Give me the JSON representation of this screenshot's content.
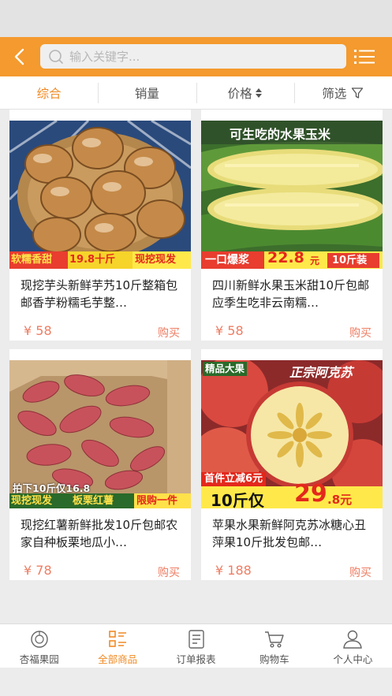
{
  "header": {
    "search_placeholder": "输入关键字..."
  },
  "filters": [
    {
      "label": "综合"
    },
    {
      "label": "销量"
    },
    {
      "label": "价格"
    },
    {
      "label": "筛选"
    }
  ],
  "products": [
    {
      "title": "现挖芋头新鲜芋艿10斤整箱包邮香芋粉糯毛芋整…",
      "price": "¥ 58",
      "buy_label": "购买",
      "image_text": {
        "left": "软糯香甜",
        "mid": "19.8十斤",
        "right": "现挖现发"
      }
    },
    {
      "title": "四川新鲜水果玉米甜10斤包邮应季生吃非云南糯…",
      "price": "¥ 58",
      "buy_label": "购买",
      "image_text": {
        "top": "可生吃的水果玉米",
        "left": "一口爆浆",
        "price": "22.8",
        "unit": "元",
        "right": "10斤装"
      }
    },
    {
      "title": "现挖红薯新鲜批发10斤包邮农家自种板栗地瓜小…",
      "price": "¥ 78",
      "buy_label": "购买",
      "image_text": {
        "line1": "拍下10斤仅16.8",
        "a": "现挖现发",
        "b": "板栗红薯",
        "c": "限购一件"
      }
    },
    {
      "title": "苹果水果新鲜阿克苏冰糖心丑萍果10斤批发包邮…",
      "price": "¥ 188",
      "buy_label": "购买",
      "image_text": {
        "tag": "精品大果",
        "brand": "正宗阿克苏",
        "promo": "首件立减6元",
        "big": "10斤仅",
        "price": "29",
        "cents": ".8元"
      }
    }
  ],
  "navbar": [
    {
      "label": "杏福果园"
    },
    {
      "label": "全部商品"
    },
    {
      "label": "订单报表"
    },
    {
      "label": "购物车"
    },
    {
      "label": "个人中心"
    }
  ],
  "colors": {
    "accent": "#f49a2e",
    "price": "#ee7d63",
    "active": "#f08a24"
  }
}
